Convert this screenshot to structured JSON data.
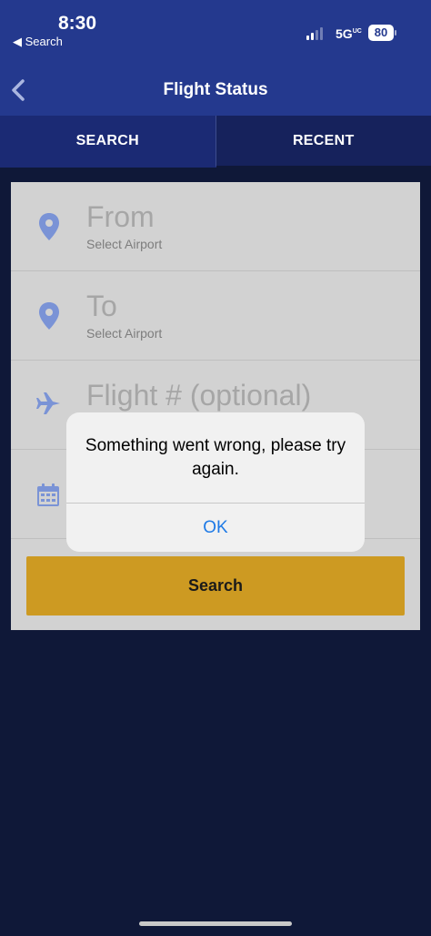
{
  "status_bar": {
    "time": "8:30",
    "back_app": "◀ Search",
    "network": "5G",
    "network_sub": "UC",
    "battery": "80"
  },
  "nav": {
    "title": "Flight Status",
    "back_icon": "chevron-left-icon"
  },
  "tabs": [
    {
      "label": "SEARCH"
    },
    {
      "label": "RECENT"
    }
  ],
  "form": {
    "from": {
      "label": "From",
      "sub": "Select Airport",
      "icon": "location-pin-icon"
    },
    "to": {
      "label": "To",
      "sub": "Select Airport",
      "icon": "location-pin-icon"
    },
    "flight": {
      "label": "Flight # (optional)",
      "icon": "airplane-icon"
    },
    "date": {
      "icon": "calendar-icon"
    },
    "search_label": "Search"
  },
  "alert": {
    "message": "Something went wrong, please try again.",
    "ok_label": "OK"
  },
  "colors": {
    "header": "#24398e",
    "background": "#0f1838",
    "accent_button": "#cd9a22",
    "icon": "#7a93d6",
    "ios_blue": "#1e7ae6"
  }
}
